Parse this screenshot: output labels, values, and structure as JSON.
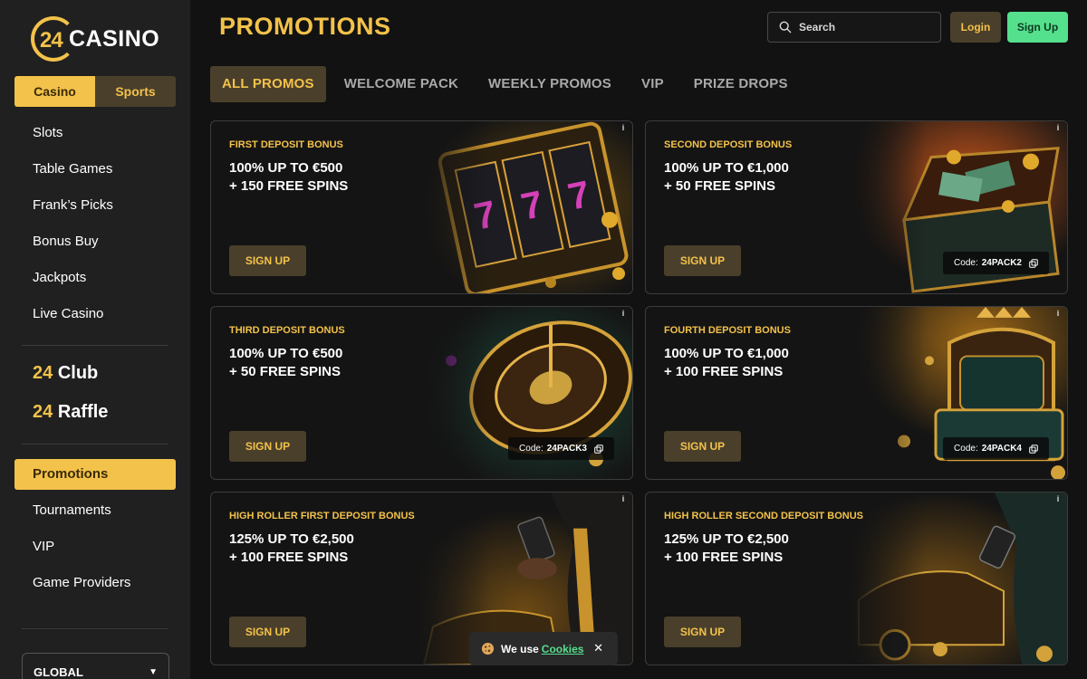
{
  "brand": {
    "number": "24",
    "word": "CASINO"
  },
  "sidebar": {
    "toggle": {
      "casino": "Casino",
      "sports": "Sports"
    },
    "items_top": [
      "Slots",
      "Table Games",
      "Frank’s Picks",
      "Bonus Buy",
      "Jackpots",
      "Live Casino"
    ],
    "club": {
      "num": "24",
      "label": "Club"
    },
    "raffle": {
      "num": "24",
      "label": "Raffle"
    },
    "active_item": "Promotions",
    "items_bottom": [
      "Tournaments",
      "VIP",
      "Game Providers"
    ],
    "region": "GLOBAL"
  },
  "header": {
    "title": "PROMOTIONS",
    "search_placeholder": "Search",
    "login": "Login",
    "signup": "Sign Up"
  },
  "tabs": [
    "ALL PROMOS",
    "WELCOME PACK",
    "WEEKLY PROMOS",
    "VIP",
    "PRIZE DROPS"
  ],
  "promos": [
    {
      "label": "FIRST DEPOSIT BONUS",
      "line1": "100% UP TO €500",
      "line2": "+ 150 FREE SPINS",
      "button": "SIGN UP",
      "code_label": "",
      "code": "",
      "info": "i"
    },
    {
      "label": "SECOND DEPOSIT BONUS",
      "line1": "100% UP TO €1,000",
      "line2": "+ 50 FREE SPINS",
      "button": "SIGN UP",
      "code_label": "Code:",
      "code": "24PACK2",
      "info": "i"
    },
    {
      "label": "THIRD DEPOSIT BONUS",
      "line1": "100% UP TO €500",
      "line2": "+ 50 FREE SPINS",
      "button": "SIGN UP",
      "code_label": "Code:",
      "code": "24PACK3",
      "info": "i"
    },
    {
      "label": "FOURTH DEPOSIT BONUS",
      "line1": "100% UP TO €1,000",
      "line2": "+ 100 FREE SPINS",
      "button": "SIGN UP",
      "code_label": "Code:",
      "code": "24PACK4",
      "info": "i"
    },
    {
      "label": "HIGH ROLLER FIRST DEPOSIT BONUS",
      "line1": "125% UP TO €2,500",
      "line2": "+ 100 FREE SPINS",
      "button": "SIGN UP",
      "code_label": "",
      "code": "",
      "info": "i"
    },
    {
      "label": "HIGH ROLLER SECOND DEPOSIT BONUS",
      "line1": "125% UP TO €2,500",
      "line2": "+ 100 FREE SPINS",
      "button": "SIGN UP",
      "code_label": "",
      "code": "",
      "info": "i"
    }
  ],
  "cookie": {
    "text": "We use",
    "link": "Cookies",
    "close": "✕"
  },
  "colors": {
    "accent": "#f3c24a",
    "accent_dark": "#4a3f2b",
    "signup_green": "#55e08d",
    "background": "#121212",
    "sidebar": "#202020"
  }
}
